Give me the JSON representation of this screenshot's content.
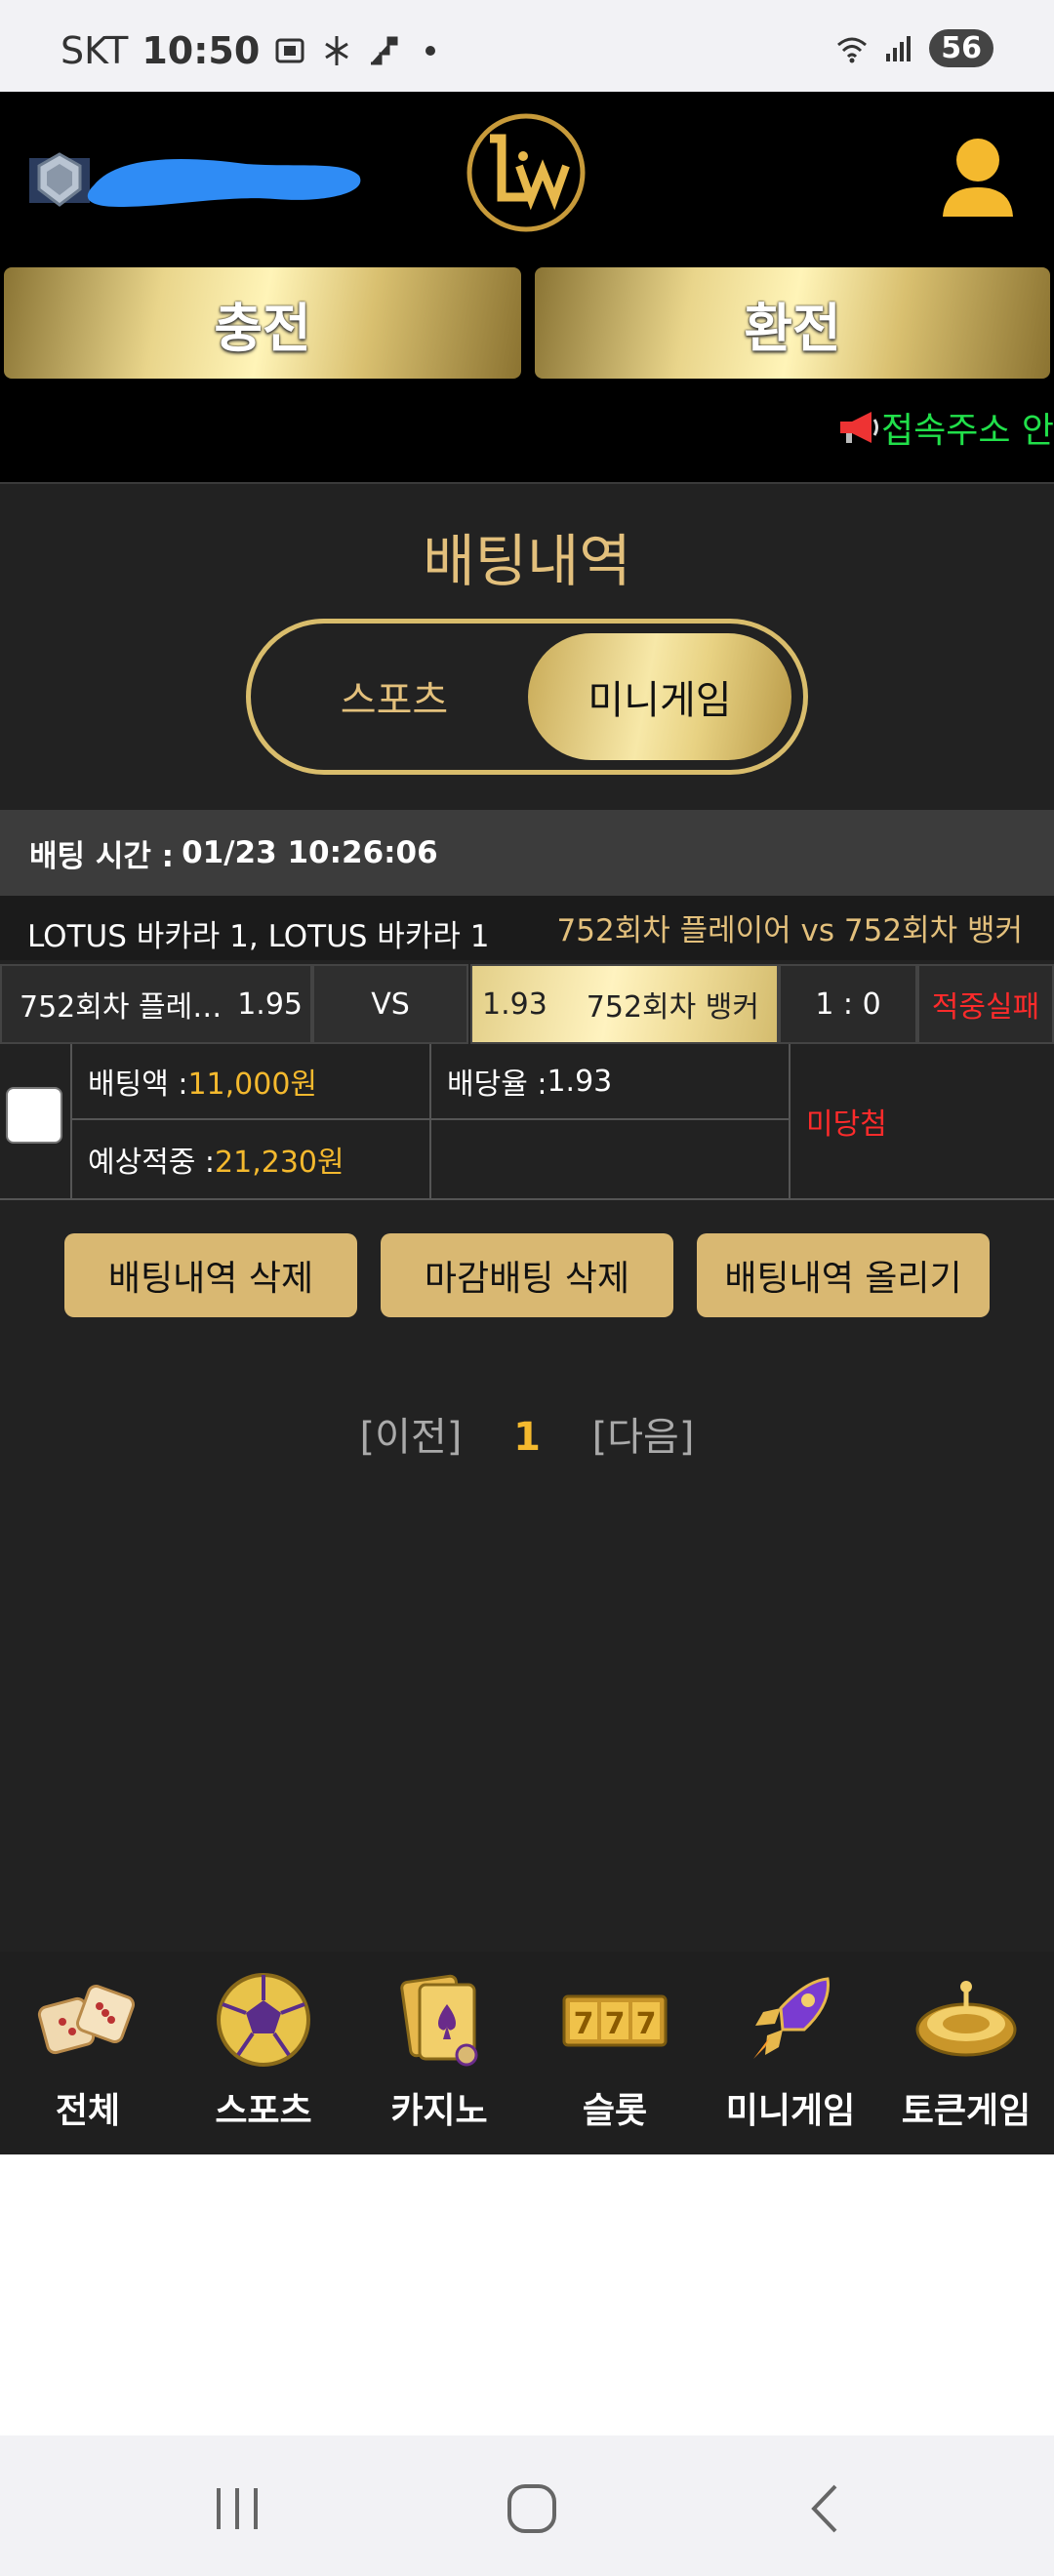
{
  "status_bar": {
    "carrier": "SKT",
    "time": "10:50",
    "battery": "56"
  },
  "header": {
    "charge_label": "충전",
    "exchange_label": "환전",
    "notice_text": "접속주소 안"
  },
  "page": {
    "title": "배팅내역",
    "tabs": [
      {
        "label": "스포츠",
        "active": false
      },
      {
        "label": "미니게임",
        "active": true
      }
    ]
  },
  "bet": {
    "time_label": "배팅 시간 :",
    "time_value": "01/23 10:26:06",
    "game_name": "LOTUS 바카라 1, LOTUS 바카라 1",
    "match_text": "752회차 플레이어  vs  752회차 뱅커",
    "player_name": "752회차 플레…",
    "player_odds": "1.95",
    "vs_label": "VS",
    "banker_odds": "1.93",
    "banker_name": "752회차 뱅커",
    "score": "1 : 0",
    "result": "적중실패",
    "amount_label": "배팅액 :",
    "amount_value": "11,000원",
    "odds_label": "배당율 :",
    "odds_value": "1.93",
    "expected_label": "예상적중 :",
    "expected_value": "21,230원",
    "status": "미당첨"
  },
  "actions": {
    "delete_history": "배팅내역 삭제",
    "delete_closed": "마감배팅 삭제",
    "upload_history": "배팅내역 올리기"
  },
  "pager": {
    "prev": "[이전]",
    "current": "1",
    "next": "[다음]"
  },
  "bottom_nav": [
    {
      "label": "전체",
      "icon": "dice-icon"
    },
    {
      "label": "스포츠",
      "icon": "soccer-ball-icon"
    },
    {
      "label": "카지노",
      "icon": "playing-card-icon"
    },
    {
      "label": "슬롯",
      "icon": "slot-777-icon"
    },
    {
      "label": "미니게임",
      "icon": "rocket-icon"
    },
    {
      "label": "토큰게임",
      "icon": "roulette-icon"
    }
  ],
  "colors": {
    "gold": "#d9b872",
    "accent_yellow": "#f4b92e",
    "fail_red": "#ff2b2b",
    "notice_green": "#21e04a"
  }
}
